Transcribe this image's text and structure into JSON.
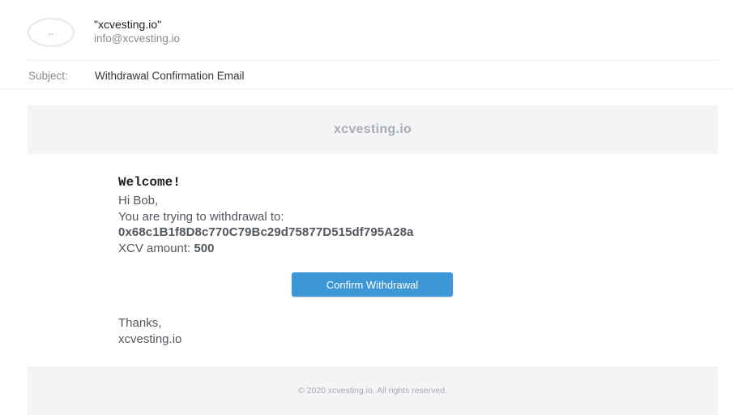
{
  "sender": {
    "avatar_initials": "..",
    "name": "\"xcvesting.io\"",
    "email": "info@xcvesting.io"
  },
  "subject": {
    "label": "Subject:",
    "value": "Withdrawal Confirmation Email"
  },
  "email": {
    "brand": "xcvesting.io",
    "welcome": "Welcome!",
    "greeting": "Hi Bob,",
    "intro": "You are trying to withdrawal to:",
    "address": "0x68c1B1f8D8c770C79Bc29d75877D515df795A28a",
    "amount_label": "XCV amount: ",
    "amount_value": "500",
    "confirm_button": "Confirm Withdrawal",
    "thanks": "Thanks,",
    "signature": "xcvesting.io",
    "footer": "© 2020 xcvesting.io. All rights reserved."
  },
  "colors": {
    "accent": "#3d96d6",
    "avatar_initials": "#27b07a",
    "panel_bg": "#f2f4f6",
    "muted_text": "#a9acb1"
  }
}
